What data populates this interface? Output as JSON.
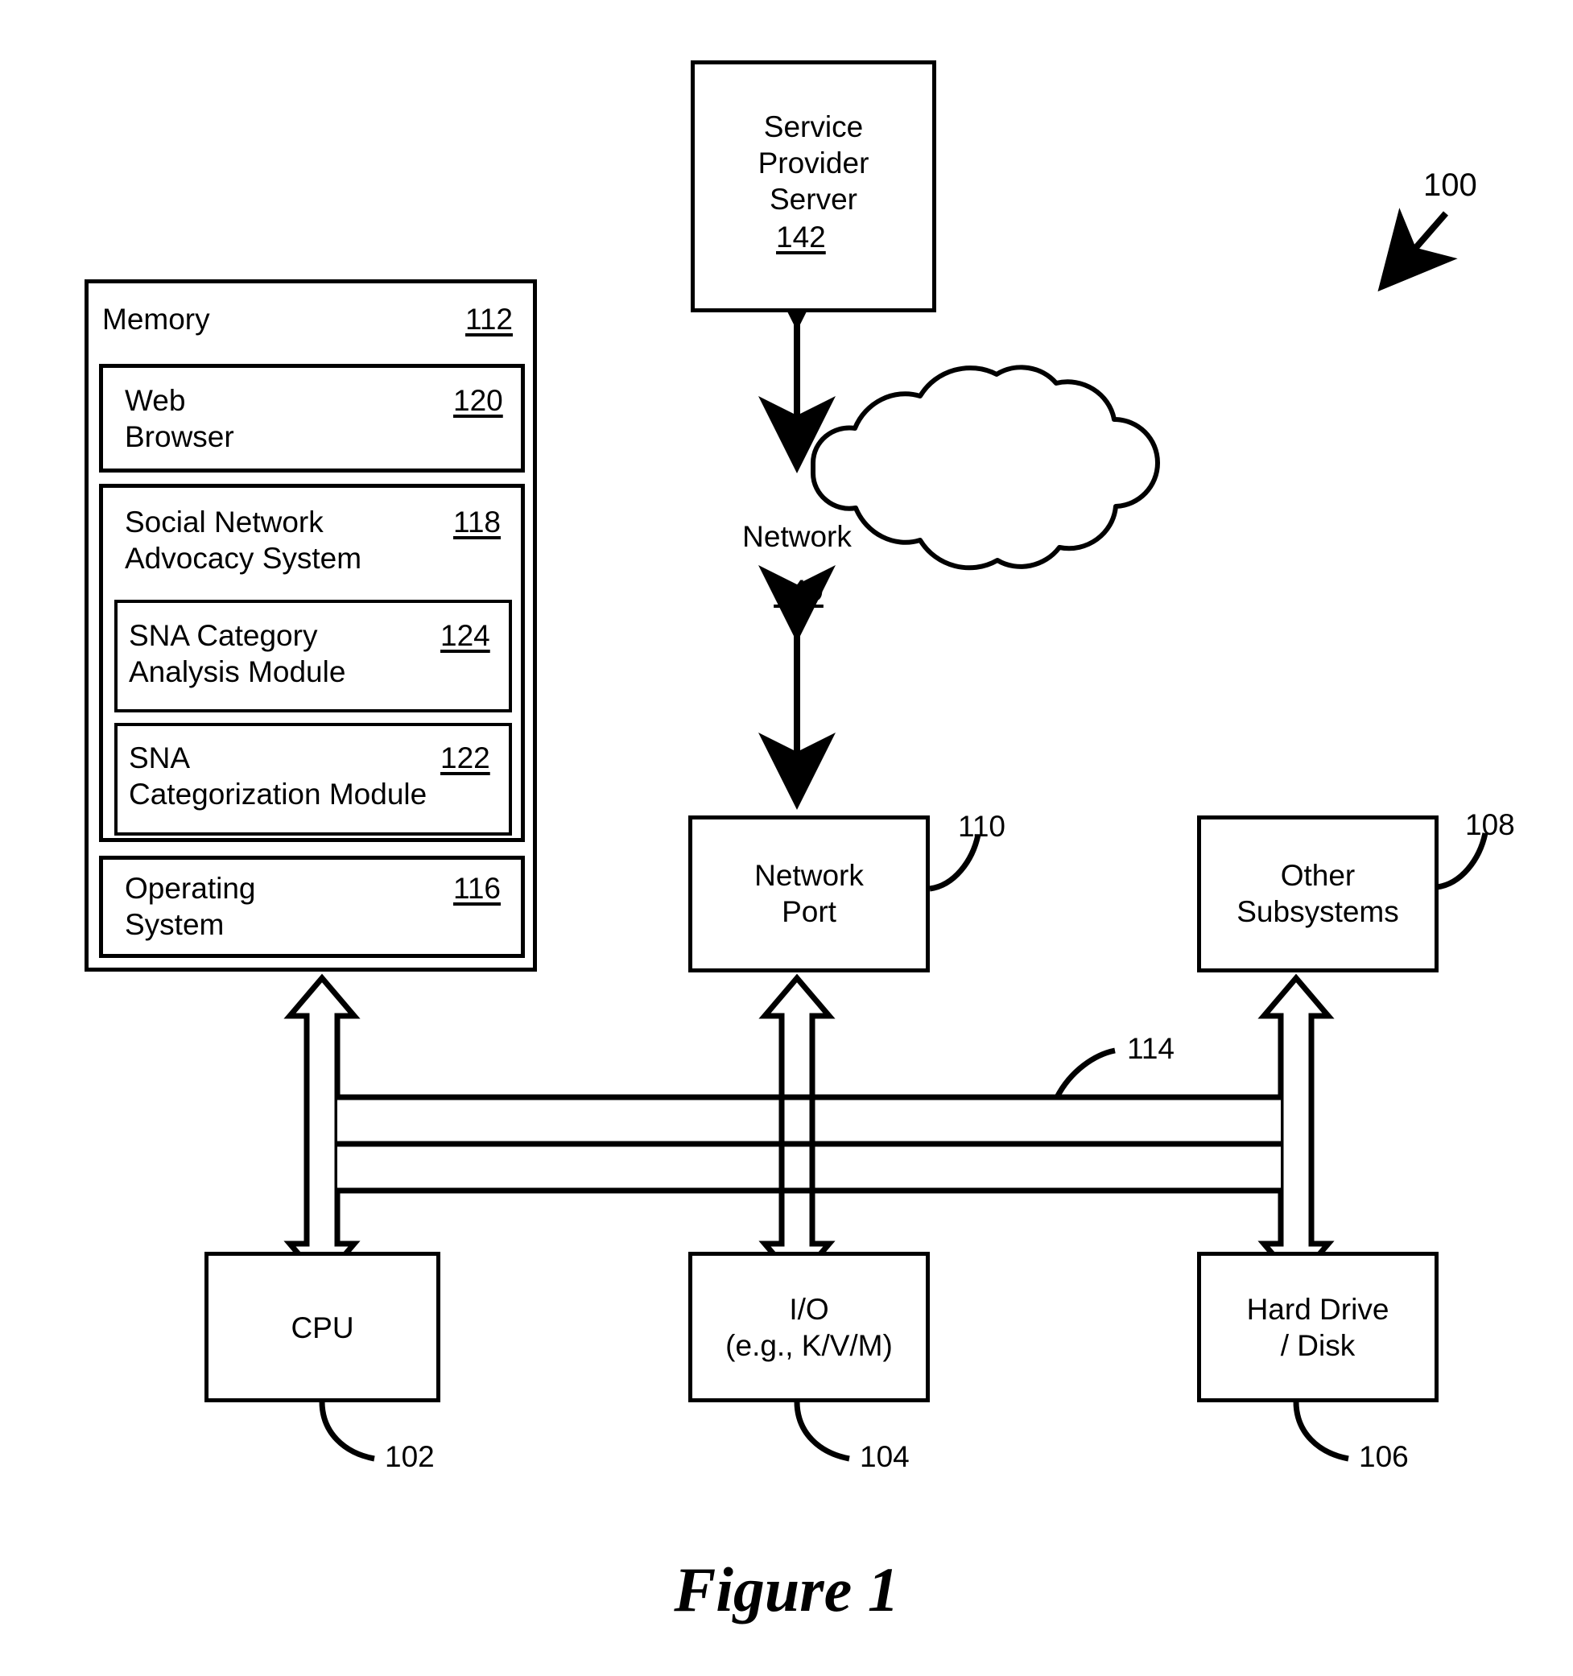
{
  "figure": {
    "caption": "Figure 1",
    "system_ref": "100"
  },
  "blocks": {
    "service_provider_server": {
      "label_line1": "Service",
      "label_line2": "Provider",
      "label_line3": "Server",
      "ref": "142"
    },
    "network_cloud": {
      "label": "Network",
      "ref": "140"
    },
    "memory": {
      "label": "Memory",
      "ref": "112",
      "modules": [
        {
          "label_line1": "Web",
          "label_line2": "Browser",
          "ref": "120"
        },
        {
          "label_line1": "Social Network",
          "label_line2": "Advocacy System",
          "ref": "118",
          "submodules": [
            {
              "label_line1": "SNA Category",
              "label_line2": "Analysis Module",
              "ref": "124"
            },
            {
              "label_line1": "SNA",
              "label_line2": "Categorization Module",
              "ref": "122"
            }
          ]
        },
        {
          "label_line1": "Operating",
          "label_line2": "System",
          "ref": "116"
        }
      ]
    },
    "network_port": {
      "label_line1": "Network",
      "label_line2": "Port",
      "ref": "110"
    },
    "other_subsystems": {
      "label_line1": "Other",
      "label_line2": "Subsystems",
      "ref": "108"
    },
    "cpu": {
      "label": "CPU",
      "ref": "102"
    },
    "io": {
      "label_line1": "I/O",
      "label_line2": "(e.g., K/V/M)",
      "ref": "104"
    },
    "hard_drive": {
      "label_line1": "Hard Drive",
      "label_line2": "/ Disk",
      "ref": "106"
    },
    "bus": {
      "ref": "114"
    }
  },
  "colors": {
    "line": "#000000",
    "background": "#ffffff"
  }
}
